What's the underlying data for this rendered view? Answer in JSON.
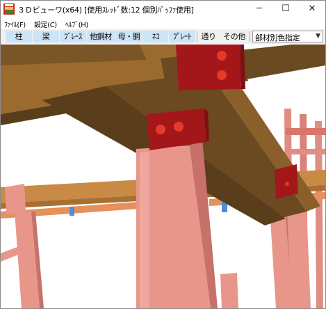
{
  "window": {
    "title": "３Ｄビューワ(x64) [使用ｽﾚｯﾄﾞ数:12 個別ﾊﾞｯﾌｧ使用]",
    "controls": {
      "minimize": "─",
      "maximize": "☐",
      "close": "✕"
    }
  },
  "menu": {
    "items": [
      {
        "label": "ﾌｧｲﾙ(F)"
      },
      {
        "label": "設定(C)"
      },
      {
        "label": "ﾍﾙﾌﾟ(H)"
      }
    ]
  },
  "toolbar": {
    "buttons": [
      {
        "label": "柱",
        "selected": true
      },
      {
        "label": "梁",
        "selected": true
      },
      {
        "label": "ﾌﾞﾚｰｽ",
        "selected": true
      },
      {
        "label": "他鋼材",
        "selected": true
      },
      {
        "label": "母・胴",
        "selected": true
      },
      {
        "label": "ﾈｺ",
        "selected": true
      },
      {
        "label": "ﾌﾟﾚｰﾄ",
        "selected": true
      },
      {
        "label": "通り",
        "selected": false
      },
      {
        "label": "その他",
        "selected": false
      }
    ],
    "color_mode": {
      "selected": "部材別色指定"
    }
  },
  "colors": {
    "beam": "#6b4a21",
    "beam_top": "#9a6a2e",
    "plate": "#a3171b",
    "bolt": "#e33a2a",
    "column": "#e8968a",
    "column_shadow": "#c8706a",
    "far_beam": "#d4873a"
  }
}
